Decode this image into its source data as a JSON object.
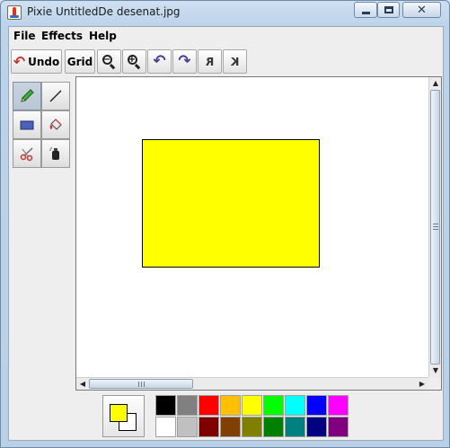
{
  "window": {
    "title": "Pixie UntitledDe desenat.jpg",
    "controls": {
      "minimize": "minimize",
      "maximize": "maximize",
      "close": "✕"
    }
  },
  "menu": {
    "items": [
      "File",
      "Effects",
      "Help"
    ]
  },
  "toolbar": {
    "undo_label": "Undo",
    "grid_label": "Grid",
    "rotate_left_glyph": "↶",
    "rotate_right_glyph": "↷",
    "flip_horizontal_glyph": "R",
    "flip_vertical_glyph": "K",
    "zoom_out_sign": "−",
    "zoom_in_sign": "+"
  },
  "tools": [
    {
      "name": "pencil-tool",
      "icon": "pencil-icon",
      "active": true
    },
    {
      "name": "line-tool",
      "icon": "line-icon",
      "active": false
    },
    {
      "name": "rectangle-tool",
      "icon": "rectangle-icon",
      "active": false
    },
    {
      "name": "fill-tool",
      "icon": "paint-bucket-icon",
      "active": false
    },
    {
      "name": "cut-tool",
      "icon": "scissors-icon",
      "active": false
    },
    {
      "name": "spray-tool",
      "icon": "spray-can-icon",
      "active": false
    }
  ],
  "canvas": {
    "background": "#ffffff",
    "shape": {
      "type": "rectangle",
      "fill": "#ffff00",
      "stroke": "#000000"
    }
  },
  "colors": {
    "foreground": "#ffff00",
    "background": "#ffffff",
    "palette_top": [
      "#000000",
      "#808080",
      "#ff0000",
      "#ffc000",
      "#ffff00",
      "#00ff00",
      "#00ffff",
      "#0000ff",
      "#ff00ff"
    ],
    "palette_bottom": [
      "#ffffff",
      "#c0c0c0",
      "#800000",
      "#804000",
      "#808000",
      "#008000",
      "#008080",
      "#000080",
      "#800080"
    ]
  }
}
